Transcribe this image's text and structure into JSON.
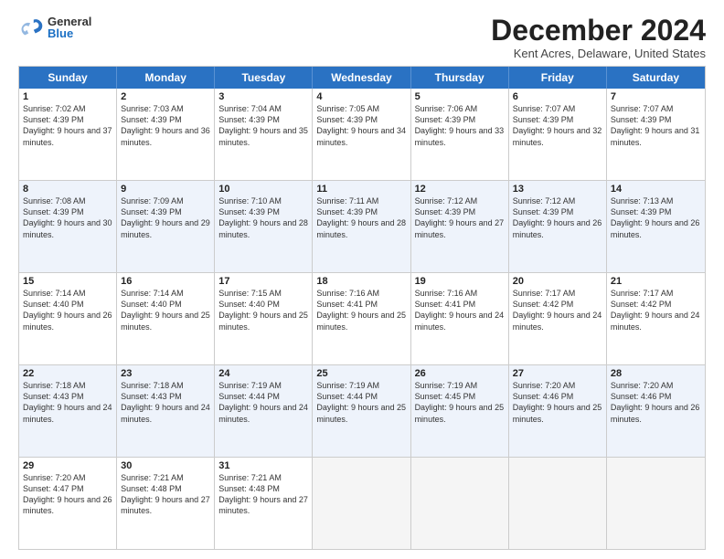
{
  "logo": {
    "general": "General",
    "blue": "Blue"
  },
  "title": "December 2024",
  "location": "Kent Acres, Delaware, United States",
  "calendar": {
    "headers": [
      "Sunday",
      "Monday",
      "Tuesday",
      "Wednesday",
      "Thursday",
      "Friday",
      "Saturday"
    ],
    "weeks": [
      [
        {
          "day": "1",
          "info": "Sunrise: 7:02 AM\nSunset: 4:39 PM\nDaylight: 9 hours and 37 minutes."
        },
        {
          "day": "2",
          "info": "Sunrise: 7:03 AM\nSunset: 4:39 PM\nDaylight: 9 hours and 36 minutes."
        },
        {
          "day": "3",
          "info": "Sunrise: 7:04 AM\nSunset: 4:39 PM\nDaylight: 9 hours and 35 minutes."
        },
        {
          "day": "4",
          "info": "Sunrise: 7:05 AM\nSunset: 4:39 PM\nDaylight: 9 hours and 34 minutes."
        },
        {
          "day": "5",
          "info": "Sunrise: 7:06 AM\nSunset: 4:39 PM\nDaylight: 9 hours and 33 minutes."
        },
        {
          "day": "6",
          "info": "Sunrise: 7:07 AM\nSunset: 4:39 PM\nDaylight: 9 hours and 32 minutes."
        },
        {
          "day": "7",
          "info": "Sunrise: 7:07 AM\nSunset: 4:39 PM\nDaylight: 9 hours and 31 minutes."
        }
      ],
      [
        {
          "day": "8",
          "info": "Sunrise: 7:08 AM\nSunset: 4:39 PM\nDaylight: 9 hours and 30 minutes."
        },
        {
          "day": "9",
          "info": "Sunrise: 7:09 AM\nSunset: 4:39 PM\nDaylight: 9 hours and 29 minutes."
        },
        {
          "day": "10",
          "info": "Sunrise: 7:10 AM\nSunset: 4:39 PM\nDaylight: 9 hours and 28 minutes."
        },
        {
          "day": "11",
          "info": "Sunrise: 7:11 AM\nSunset: 4:39 PM\nDaylight: 9 hours and 28 minutes."
        },
        {
          "day": "12",
          "info": "Sunrise: 7:12 AM\nSunset: 4:39 PM\nDaylight: 9 hours and 27 minutes."
        },
        {
          "day": "13",
          "info": "Sunrise: 7:12 AM\nSunset: 4:39 PM\nDaylight: 9 hours and 26 minutes."
        },
        {
          "day": "14",
          "info": "Sunrise: 7:13 AM\nSunset: 4:39 PM\nDaylight: 9 hours and 26 minutes."
        }
      ],
      [
        {
          "day": "15",
          "info": "Sunrise: 7:14 AM\nSunset: 4:40 PM\nDaylight: 9 hours and 26 minutes."
        },
        {
          "day": "16",
          "info": "Sunrise: 7:14 AM\nSunset: 4:40 PM\nDaylight: 9 hours and 25 minutes."
        },
        {
          "day": "17",
          "info": "Sunrise: 7:15 AM\nSunset: 4:40 PM\nDaylight: 9 hours and 25 minutes."
        },
        {
          "day": "18",
          "info": "Sunrise: 7:16 AM\nSunset: 4:41 PM\nDaylight: 9 hours and 25 minutes."
        },
        {
          "day": "19",
          "info": "Sunrise: 7:16 AM\nSunset: 4:41 PM\nDaylight: 9 hours and 24 minutes."
        },
        {
          "day": "20",
          "info": "Sunrise: 7:17 AM\nSunset: 4:42 PM\nDaylight: 9 hours and 24 minutes."
        },
        {
          "day": "21",
          "info": "Sunrise: 7:17 AM\nSunset: 4:42 PM\nDaylight: 9 hours and 24 minutes."
        }
      ],
      [
        {
          "day": "22",
          "info": "Sunrise: 7:18 AM\nSunset: 4:43 PM\nDaylight: 9 hours and 24 minutes."
        },
        {
          "day": "23",
          "info": "Sunrise: 7:18 AM\nSunset: 4:43 PM\nDaylight: 9 hours and 24 minutes."
        },
        {
          "day": "24",
          "info": "Sunrise: 7:19 AM\nSunset: 4:44 PM\nDaylight: 9 hours and 24 minutes."
        },
        {
          "day": "25",
          "info": "Sunrise: 7:19 AM\nSunset: 4:44 PM\nDaylight: 9 hours and 25 minutes."
        },
        {
          "day": "26",
          "info": "Sunrise: 7:19 AM\nSunset: 4:45 PM\nDaylight: 9 hours and 25 minutes."
        },
        {
          "day": "27",
          "info": "Sunrise: 7:20 AM\nSunset: 4:46 PM\nDaylight: 9 hours and 25 minutes."
        },
        {
          "day": "28",
          "info": "Sunrise: 7:20 AM\nSunset: 4:46 PM\nDaylight: 9 hours and 26 minutes."
        }
      ],
      [
        {
          "day": "29",
          "info": "Sunrise: 7:20 AM\nSunset: 4:47 PM\nDaylight: 9 hours and 26 minutes."
        },
        {
          "day": "30",
          "info": "Sunrise: 7:21 AM\nSunset: 4:48 PM\nDaylight: 9 hours and 27 minutes."
        },
        {
          "day": "31",
          "info": "Sunrise: 7:21 AM\nSunset: 4:48 PM\nDaylight: 9 hours and 27 minutes."
        },
        {
          "day": "",
          "info": ""
        },
        {
          "day": "",
          "info": ""
        },
        {
          "day": "",
          "info": ""
        },
        {
          "day": "",
          "info": ""
        }
      ]
    ]
  }
}
